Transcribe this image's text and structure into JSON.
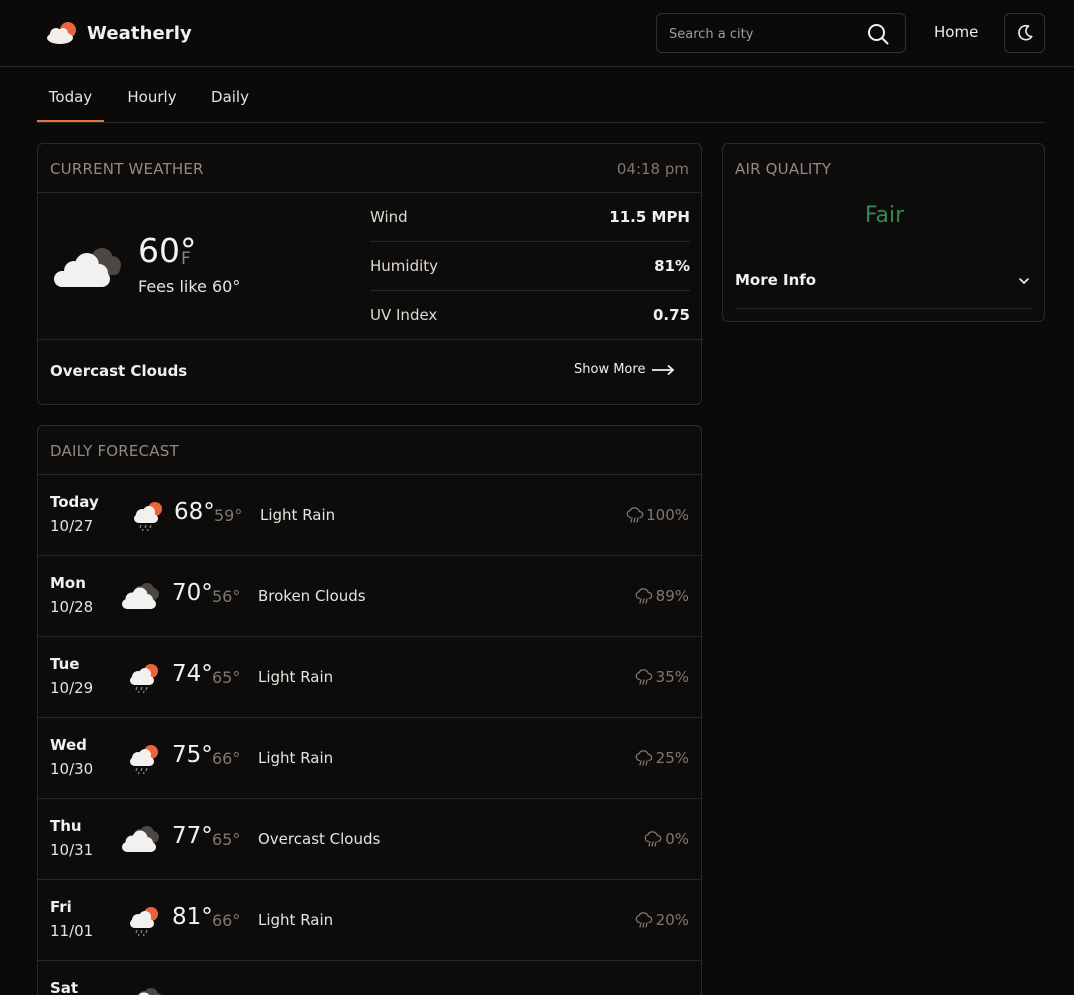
{
  "app": {
    "name": "Weatherly"
  },
  "header": {
    "search_placeholder": "Search a city",
    "home_label": "Home"
  },
  "tabs": [
    {
      "label": "Today",
      "active": true
    },
    {
      "label": "Hourly",
      "active": false
    },
    {
      "label": "Daily",
      "active": false
    }
  ],
  "current": {
    "title": "CURRENT WEATHER",
    "time": "04:18 pm",
    "temp": "60°",
    "unit": "F",
    "feels_like": "Fees like 60°",
    "icon": "overcast-clouds-icon",
    "condition": "Overcast Clouds",
    "show_more": "Show More",
    "metrics": [
      {
        "label": "Wind",
        "value": "11.5 MPH"
      },
      {
        "label": "Humidity",
        "value": "81%"
      },
      {
        "label": "UV Index",
        "value": "0.75"
      }
    ]
  },
  "air_quality": {
    "title": "AIR QUALITY",
    "value": "Fair",
    "value_color": "#2e8a4f",
    "more_info": "More Info"
  },
  "daily": {
    "title": "DAILY FORECAST",
    "days": [
      {
        "name": "Today",
        "date": "10/27",
        "hi": "68°",
        "lo": "59°",
        "cond": "Light Rain",
        "pop": "100%",
        "icon": "light-rain"
      },
      {
        "name": "Mon",
        "date": "10/28",
        "hi": "70°",
        "lo": "56°",
        "cond": "Broken Clouds",
        "pop": "89%",
        "icon": "broken-clouds"
      },
      {
        "name": "Tue",
        "date": "10/29",
        "hi": "74°",
        "lo": "65°",
        "cond": "Light Rain",
        "pop": "35%",
        "icon": "light-rain"
      },
      {
        "name": "Wed",
        "date": "10/30",
        "hi": "75°",
        "lo": "66°",
        "cond": "Light Rain",
        "pop": "25%",
        "icon": "light-rain"
      },
      {
        "name": "Thu",
        "date": "10/31",
        "hi": "77°",
        "lo": "65°",
        "cond": "Overcast Clouds",
        "pop": "0%",
        "icon": "broken-clouds"
      },
      {
        "name": "Fri",
        "date": "11/01",
        "hi": "81°",
        "lo": "66°",
        "cond": "Light Rain",
        "pop": "20%",
        "icon": "light-rain"
      },
      {
        "name": "Sat",
        "date": "",
        "hi": "",
        "lo": "",
        "cond": "",
        "pop": "",
        "icon": "broken-clouds"
      }
    ]
  },
  "colors": {
    "accent": "#e2763b",
    "background": "#0b0a09",
    "good": "#2e8a4f"
  }
}
